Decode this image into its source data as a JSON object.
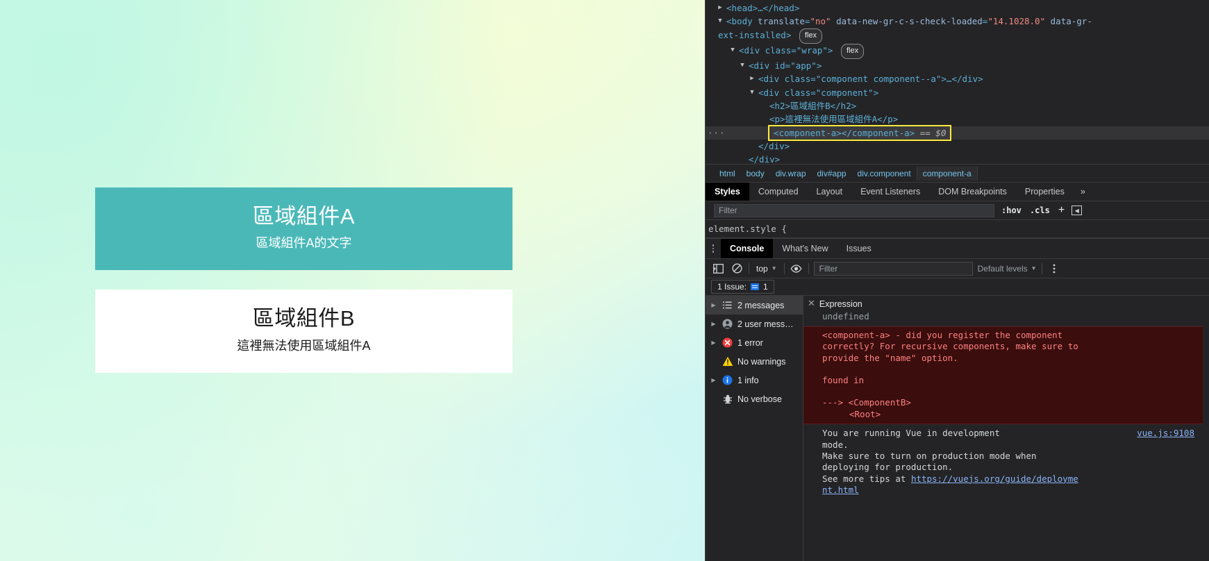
{
  "page": {
    "component_a": {
      "title": "區域組件A",
      "text": "區域組件A的文字",
      "bg_color": "#4bb8b8"
    },
    "component_b": {
      "title": "區域組件B",
      "text": "這裡無法使用區域組件A",
      "bg_color": "#ffffff"
    }
  },
  "devtools": {
    "dom_tree": {
      "head_line": "<head>…</head>",
      "body_open": "<body translate=\"no\" data-new-gr-c-s-check-loaded=\"14.1028.0\" data-gr-",
      "body_tag": "body",
      "body_attr1": "translate",
      "body_attr1_val": "\"no\"",
      "body_attr2": "data-new-gr-c-s-check-loaded",
      "body_attr2_val": "\"14.1028.0\"",
      "body_attr3": "data-gr-",
      "body_cont": "ext-installed>",
      "flex_badge": "flex",
      "wrap_line": "<div class=\"wrap\">",
      "app_line": "<div id=\"app\">",
      "comp_a_line": "<div class=\"component  component--a\">…</div>",
      "comp_b_line": "<div class=\"component\">",
      "h2_line": "<h2>區域組件B</h2>",
      "p_line": "<p>這裡無法使用區域組件A</p>",
      "selected_line": "<component-a></component-a>",
      "selected_suffix": "== $0",
      "close_div_1": "</div>",
      "close_div_2": "</div>",
      "gutter_ellipsis": "···"
    },
    "breadcrumbs": [
      "html",
      "body",
      "div.wrap",
      "div#app",
      "div.component",
      "component-a"
    ],
    "breadcrumb_active": "component-a",
    "elements_tabs": [
      "Styles",
      "Computed",
      "Layout",
      "Event Listeners",
      "DOM Breakpoints",
      "Properties"
    ],
    "elements_tab_active": "Styles",
    "elements_tabs_more": "»",
    "styles_filter_placeholder": "Filter",
    "styles_toolbar": {
      "hov": ":hov",
      "cls": ".cls",
      "plus": "+",
      "sidebar_toggle": "◀"
    },
    "element_style_rule": "element.style {",
    "drawer_tabs": [
      "Console",
      "What's New",
      "Issues"
    ],
    "drawer_tab_active": "Console",
    "console_toolbar": {
      "sidebar_toggle_icon": "sidebar-toggle-icon",
      "clear_icon": "clear-console-icon",
      "context": "top",
      "eye_icon": "live-expression-icon",
      "filter_placeholder": "Filter",
      "levels": "Default levels",
      "levels_caret": "▼",
      "settings_icon": "settings-icon"
    },
    "issue_bar": {
      "label": "1 Issue:",
      "count": "1"
    },
    "console_sidebar": [
      {
        "label": "2 messages",
        "icon": "list-icon",
        "expandable": true,
        "selected": true
      },
      {
        "label": "2 user mess…",
        "icon": "user-icon",
        "expandable": true,
        "selected": false
      },
      {
        "label": "1 error",
        "icon": "error-icon",
        "expandable": true,
        "selected": false
      },
      {
        "label": "No warnings",
        "icon": "warning-icon",
        "expandable": false,
        "selected": false
      },
      {
        "label": "1 info",
        "icon": "info-icon",
        "expandable": true,
        "selected": false
      },
      {
        "label": "No verbose",
        "icon": "verbose-icon",
        "expandable": false,
        "selected": false
      }
    ],
    "console_messages": {
      "expression_label": "Expression",
      "expression_value": "undefined",
      "error_text": "<component-a> - did you register the component\ncorrectly? For recursive components, make sure to\nprovide the \"name\" option.",
      "error_found_in": "found in",
      "error_trace_1": "---> <ComponentB>",
      "error_trace_2": "<Root>",
      "info_line1": "You are running Vue in development",
      "info_line2": "mode.",
      "info_line3": "Make sure to turn on production mode when",
      "info_line4": "deploying for production.",
      "info_line5_pre": "See more tips at ",
      "info_link": "https://vuejs.org/guide/deployme",
      "info_link_2": "nt.html",
      "source_link": "vue.js:9108"
    }
  }
}
